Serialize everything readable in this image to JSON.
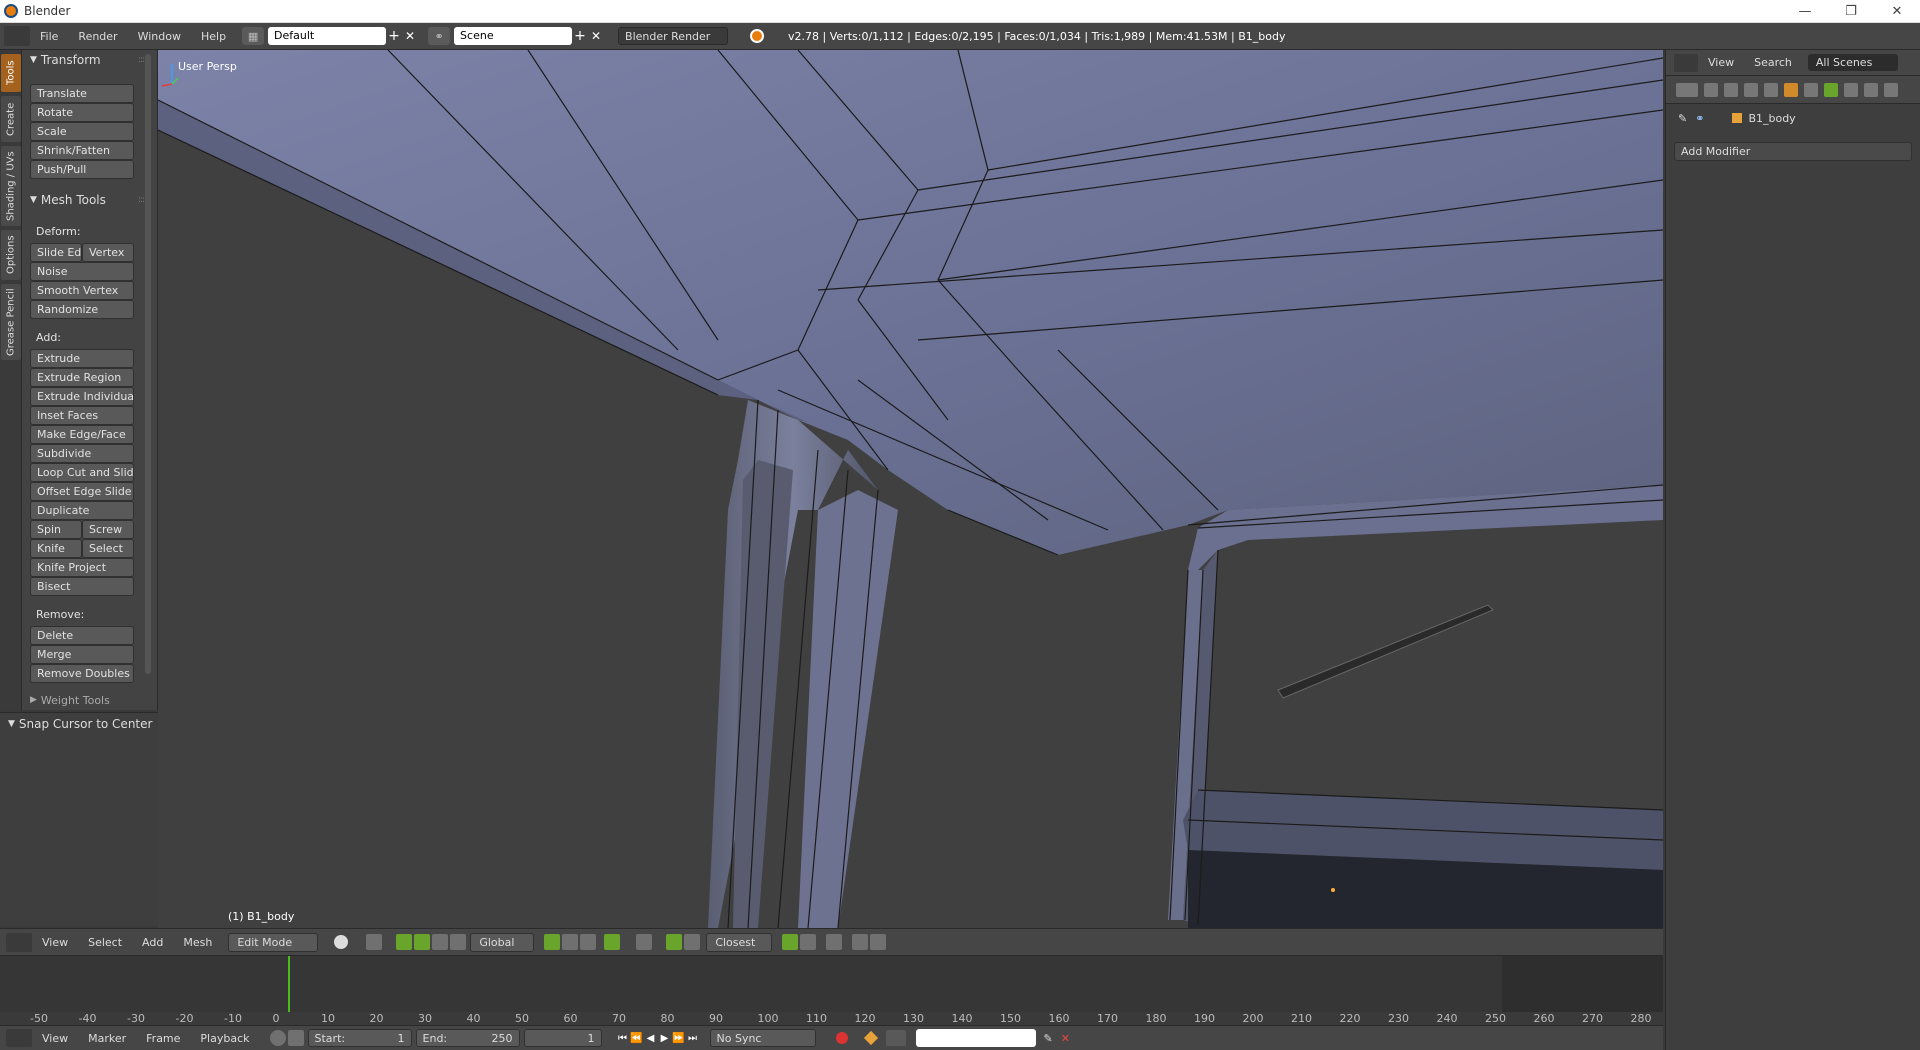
{
  "window": {
    "title": "Blender",
    "minimize": "—",
    "maximize": "❐",
    "close": "✕"
  },
  "topbar": {
    "menus": [
      "File",
      "Render",
      "Window",
      "Help"
    ],
    "layout": "Default",
    "scene": "Scene",
    "engine": "Blender Render",
    "stats": "v2.78 | Verts:0/1,112 | Edges:0/2,195 | Faces:0/1,034 | Tris:1,989 | Mem:41.53M | B1_body"
  },
  "tabs": [
    "Tools",
    "Create",
    "Shading / UVs",
    "Options",
    "Grease Pencil"
  ],
  "toolshelf": {
    "transform_title": "Transform",
    "transform": [
      "Translate",
      "Rotate",
      "Scale",
      "Shrink/Fatten",
      "Push/Pull"
    ],
    "meshtools_title": "Mesh Tools",
    "deform_label": "Deform:",
    "slide_edge": "Slide Ed",
    "vertex": "Vertex",
    "noise": "Noise",
    "smooth_vertex": "Smooth Vertex",
    "randomize": "Randomize",
    "add_label": "Add:",
    "extrude": "Extrude",
    "extrude_region": "Extrude Region",
    "extrude_individual": "Extrude Individual",
    "inset_faces": "Inset Faces",
    "make_edge_face": "Make Edge/Face",
    "subdivide": "Subdivide",
    "loop_cut": "Loop Cut and Slide",
    "offset_edge": "Offset Edge Slide",
    "duplicate": "Duplicate",
    "spin": "Spin",
    "screw": "Screw",
    "knife": "Knife",
    "select": "Select",
    "knife_project": "Knife Project",
    "bisect": "Bisect",
    "remove_label": "Remove:",
    "delete": "Delete",
    "merge": "Merge",
    "remove_doubles": "Remove Doubles",
    "weight_tools": "Weight Tools",
    "snap_cursor": "Snap Cursor to Center"
  },
  "viewport": {
    "label": "User Persp",
    "object": "(1) B1_body"
  },
  "properties": {
    "view": "View",
    "search": "Search",
    "scenes": "All Scenes",
    "object": "B1_body",
    "add_modifier": "Add Modifier"
  },
  "vheader": {
    "view": "View",
    "select": "Select",
    "add": "Add",
    "mesh": "Mesh",
    "mode": "Edit Mode",
    "orientation": "Global",
    "snap": "Closest"
  },
  "timeline": {
    "ticks": [
      "-50",
      "-40",
      "-30",
      "-20",
      "-10",
      "0",
      "10",
      "20",
      "30",
      "40",
      "50",
      "60",
      "70",
      "80",
      "90",
      "100",
      "110",
      "120",
      "130",
      "140",
      "150",
      "160",
      "170",
      "180",
      "190",
      "200",
      "210",
      "220",
      "230",
      "240",
      "250",
      "260",
      "270",
      "280"
    ]
  },
  "bottombar": {
    "view": "View",
    "marker": "Marker",
    "frame": "Frame",
    "playback": "Playback",
    "start_label": "Start:",
    "start": "1",
    "end_label": "End:",
    "end": "250",
    "current": "1",
    "sync": "No Sync"
  }
}
